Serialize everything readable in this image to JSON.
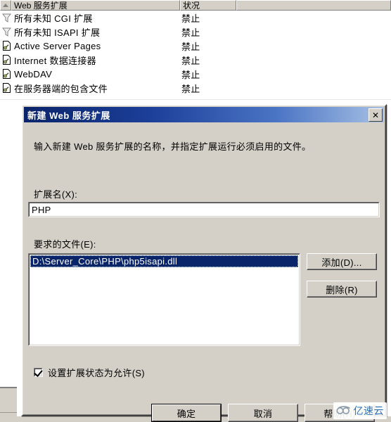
{
  "background": {
    "listview": {
      "columns": [
        {
          "key": "sort",
          "label": ""
        },
        {
          "key": "name",
          "label": "Web 服务扩展"
        },
        {
          "key": "status",
          "label": "状况"
        },
        {
          "key": "rest",
          "label": ""
        }
      ],
      "rows": [
        {
          "icon": "filter-icon",
          "name": "所有未知 CGI 扩展",
          "status": "禁止"
        },
        {
          "icon": "filter-icon",
          "name": "所有未知 ISAPI 扩展",
          "status": "禁止"
        },
        {
          "icon": "extension-file-icon",
          "name": "Active Server Pages",
          "status": "禁止"
        },
        {
          "icon": "extension-file-icon",
          "name": "Internet 数据连接器",
          "status": "禁止"
        },
        {
          "icon": "extension-file-icon",
          "name": "WebDAV",
          "status": "禁止"
        },
        {
          "icon": "extension-file-icon",
          "name": "在服务器端的包含文件",
          "status": "禁止"
        }
      ]
    }
  },
  "dialog": {
    "title": "新建 Web 服务扩展",
    "close_label": "✕",
    "instruction": "输入新建 Web 服务扩展的名称，并指定扩展运行必须启用的文件。",
    "extension_name": {
      "label": "扩展名(X):",
      "value": "PHP"
    },
    "required_files": {
      "label": "要求的文件(E):",
      "items": [
        {
          "path": "D:\\Server_Core\\PHP\\php5isapi.dll",
          "selected": true
        }
      ],
      "add_button": "添加(D)...",
      "remove_button": "删除(R)"
    },
    "checkbox": {
      "label": "设置扩展状态为允许(S)",
      "checked": true
    },
    "buttons": {
      "ok": "确定",
      "cancel": "取消",
      "help": "帮助(H)"
    }
  },
  "watermark": {
    "text": "亿速云",
    "color": "#2b6fb5"
  },
  "colors": {
    "dialog_face": "#d4d0c8",
    "titlebar_start": "#0a246a",
    "titlebar_end": "#a7c0e4",
    "selection": "#0a246a",
    "field_bg": "#ffffff"
  }
}
